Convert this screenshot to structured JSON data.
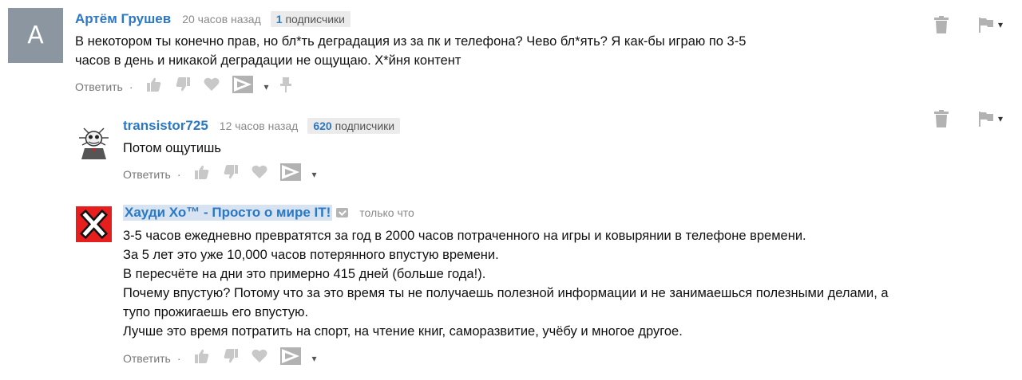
{
  "comments": [
    {
      "author": "Артём Грушев",
      "avatar_letter": "А",
      "time": "20 часов назад",
      "subs_count": "1",
      "subs_label": "подписчики",
      "lines": [
        "В некотором ты конечно прав, но бл*ть деградация из за пк и телефона? Чево бл*ять? Я как-бы играю по 3-5",
        "часов в день и никакой деградации не ощущаю. Х*йня контент"
      ],
      "reply_label": "Ответить"
    },
    {
      "author": "transistor725",
      "time": "12 часов назад",
      "subs_count": "620",
      "subs_label": "подписчики",
      "lines": [
        "Потом ощутишь"
      ],
      "reply_label": "Ответить"
    },
    {
      "author": "Хауди Хо™ - Просто о мире IT!",
      "time": "только что",
      "lines": [
        "3-5 часов ежедневно превратятся за год в 2000 часов потраченного на игры и ковырянии в телефоне времени.",
        "За 5 лет это уже 10,000 часов потерянного впустую времени.",
        "В пересчёте на дни это примерно 415 дней (больше года!).",
        "Почему впустую? Потому что за это время ты не получаешь полезной информации и не занимаешься полезными делами, а",
        "тупо прожигаешь его впустую.",
        "Лучше это время потратить на спорт, на чтение книг, саморазвитие, учёбу и многое другое."
      ],
      "reply_label": "Ответить"
    }
  ],
  "separator": "·",
  "menu_caret": "▾",
  "icons": [
    "trash-icon",
    "flag-icon",
    "thumbs-up-icon",
    "thumbs-down-icon",
    "heart-icon",
    "promote-icon",
    "pin-icon",
    "verified-icon"
  ],
  "colors": {
    "author": "#2b78c5",
    "avatar_a": "#8c96a0",
    "avatar_x": "#e61e1e",
    "icon": "#c8c8c8"
  }
}
